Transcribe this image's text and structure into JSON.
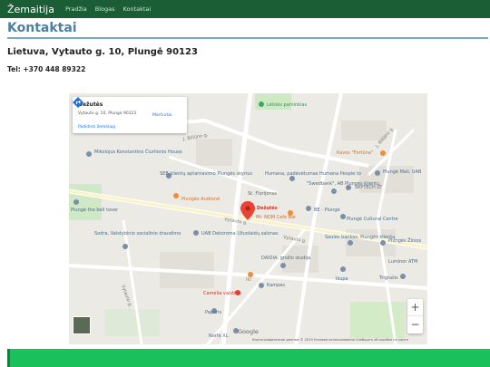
{
  "navbar": {
    "brand": "Žemaitija",
    "links": [
      "Pradžia",
      "Blogas",
      "Kontaktai"
    ]
  },
  "page": {
    "title": "Kontaktai",
    "address": "Lietuva, Vytauto g. 10, Plungė 90123",
    "phone": "Tel: +370 448 89322"
  },
  "map": {
    "card": {
      "title": "Dežutės",
      "address": "Vytauto g. 10, Plungė 90123",
      "directions": "Maršrutai",
      "larger_map": "Padidinti žemėlapį"
    },
    "poi": [
      "Lėlsiės paminklas",
      "Mikolojus Konstantino Čiurlionio House",
      "Plungė the bell tover",
      "Kavos \"Fortūna\"",
      "Plungės Audronė",
      "SEB klientų aptarnavimo Plungės skyrius",
      "Humana, padėvėtumas Humana People to",
      "\"Swedbank\", AB Plungės klientų",
      "SKYTECH LT",
      "Plungė Mall, UAB",
      "St. Florijonas",
      "Dežutės",
      "Mr. NOM Cafe Bar",
      "BE - Plungė",
      "Plungė Cultural Centre",
      "Sodra, Valstybinio socialinio draudimo",
      "UAB Dekoroma Užuolaidų salonas",
      "Saulės bankas, Plungės klientų",
      "Plungės Žinios",
      "Luminor ATM",
      "DAIDIA, grožio studija",
      "Iki",
      "Kampas",
      "Camelia vaistinė",
      "Paparis",
      "Trigrašis",
      "Norfa XL",
      "Ikupa"
    ],
    "streets": [
      "J. Biliūno g.",
      "Vytauto g.",
      "Vytauto g.",
      "Vytauto g.",
      "J. Biliūno g."
    ],
    "google": "Google",
    "attribution": "Картографические данные © 2019    Условия использования    Сообщить об ошибке на карте",
    "zoom_in": "+",
    "zoom_out": "−"
  },
  "colors": {
    "navbar": "#1b5e36",
    "title": "#4a7fa6",
    "banner": "#1ac15b",
    "marker": "#ea4335"
  }
}
